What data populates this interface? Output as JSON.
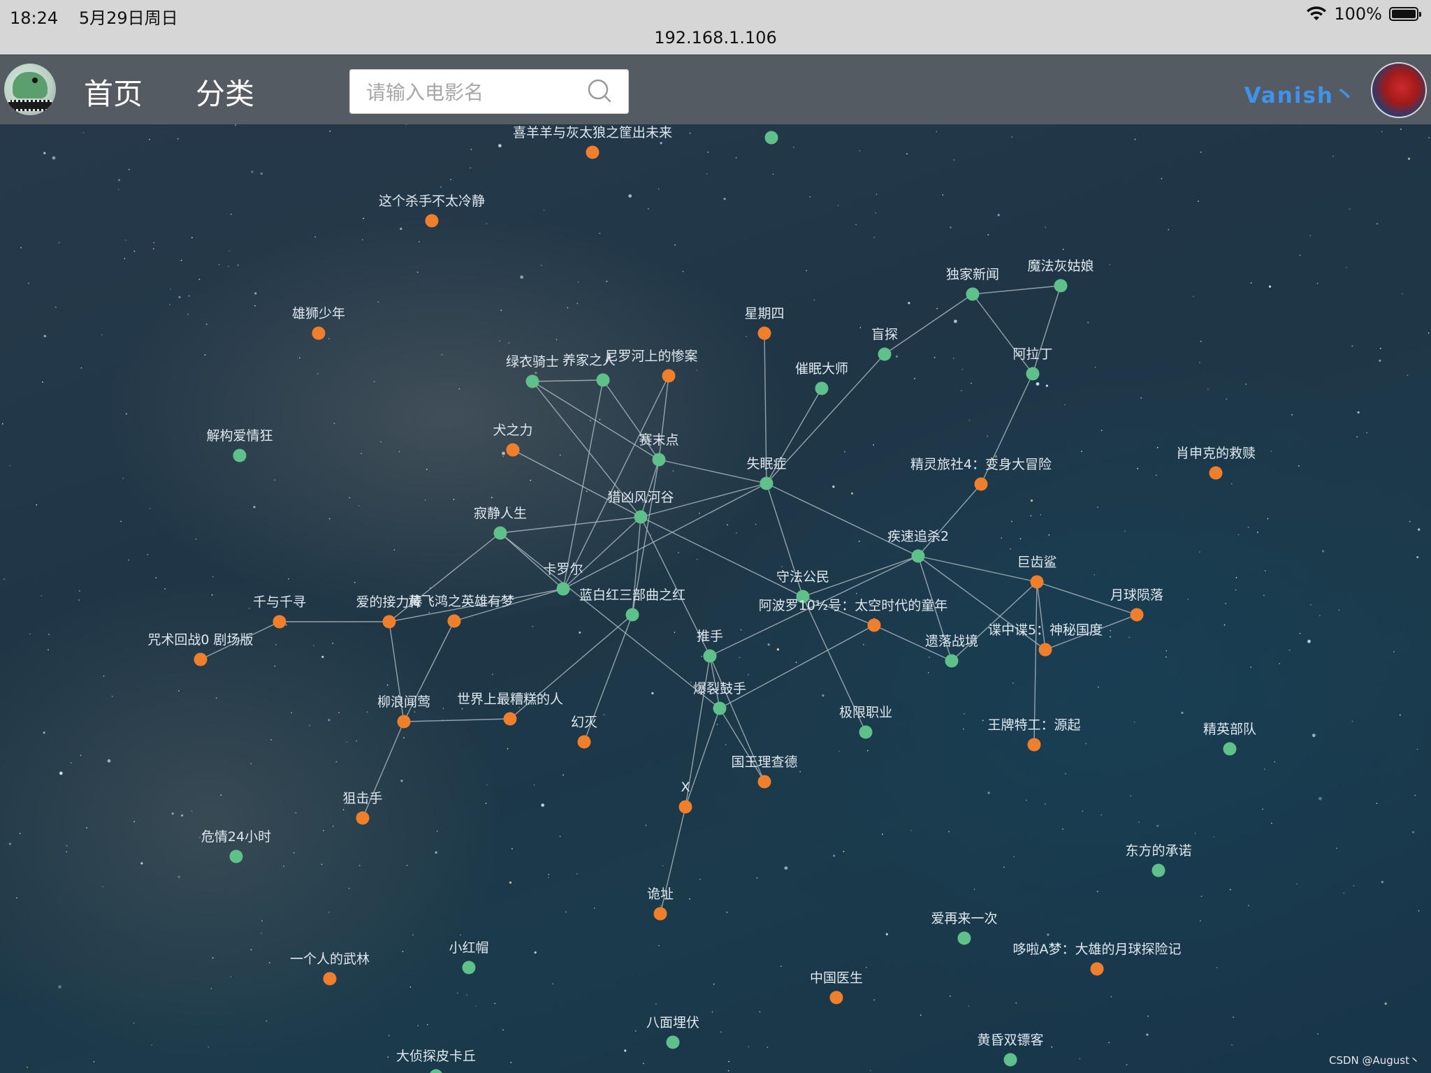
{
  "status_bar": {
    "time": "18:24",
    "date": "5月29日周日",
    "battery": "100%"
  },
  "browser": {
    "url": "192.168.1.106"
  },
  "header": {
    "nav": [
      "首页",
      "分类"
    ],
    "search_placeholder": "请输入电影名",
    "username": "Vanish丶"
  },
  "colors": {
    "green": "#5ec18a",
    "orange": "#f07f2b",
    "edge": "#a9b6bd",
    "header_bg": "#545b62",
    "username": "#3f93ea"
  },
  "graph": {
    "nodes": [
      {
        "id": "喜羊羊与灰太狼之筐出未来",
        "t": "o"
      },
      {
        "id": "这个杀手不太冷静",
        "t": "o"
      },
      {
        "id": "雄狮少年",
        "t": "o"
      },
      {
        "id": "解构爱情狂",
        "t": "g"
      },
      {
        "id": "绿衣骑士",
        "t": "g"
      },
      {
        "id": "养家之人",
        "t": "g"
      },
      {
        "id": "尼罗河上的惨案",
        "t": "o"
      },
      {
        "id": "星期四",
        "t": "o"
      },
      {
        "id": "独家新闻",
        "t": "g"
      },
      {
        "id": "魔法灰姑娘",
        "t": "g"
      },
      {
        "id": "盲探",
        "t": "g"
      },
      {
        "id": "催眠大师",
        "t": "g"
      },
      {
        "id": "阿拉丁",
        "t": "g"
      },
      {
        "id": "犬之力",
        "t": "o"
      },
      {
        "id": "赛末点",
        "t": "g"
      },
      {
        "id": "失眠症",
        "t": "g"
      },
      {
        "id": "精灵旅社4：变身大冒险",
        "t": "o"
      },
      {
        "id": "肖申克的救赎",
        "t": "o"
      },
      {
        "id": "猎凶风河谷",
        "t": "g"
      },
      {
        "id": "寂静人生",
        "t": "g"
      },
      {
        "id": "疾速追杀2",
        "t": "g"
      },
      {
        "id": "巨齿鲨",
        "t": "o"
      },
      {
        "id": "卡罗尔",
        "t": "g"
      },
      {
        "id": "守法公民",
        "t": "g"
      },
      {
        "id": "月球陨落",
        "t": "o"
      },
      {
        "id": "千与千寻",
        "t": "o"
      },
      {
        "id": "爱的接力棒",
        "t": "o"
      },
      {
        "id": "黄飞鸿之英雄有梦",
        "t": "o"
      },
      {
        "id": "蓝白红三部曲之红",
        "t": "g"
      },
      {
        "id": "阿波罗10½号：太空时代的童年",
        "t": "o"
      },
      {
        "id": "谍中谍5：神秘国度",
        "t": "o"
      },
      {
        "id": "咒术回战0 剧场版",
        "t": "o"
      },
      {
        "id": "推手",
        "t": "g"
      },
      {
        "id": "遗落战境",
        "t": "g"
      },
      {
        "id": "爆裂鼓手",
        "t": "g"
      },
      {
        "id": "柳浪闻莺",
        "t": "o"
      },
      {
        "id": "世界上最糟糕的人",
        "t": "o"
      },
      {
        "id": "极限职业",
        "t": "g"
      },
      {
        "id": "幻灭",
        "t": "o"
      },
      {
        "id": "王牌特工：源起",
        "t": "o"
      },
      {
        "id": "精英部队",
        "t": "g"
      },
      {
        "id": "国王理查德",
        "t": "o"
      },
      {
        "id": "狙击手",
        "t": "o"
      },
      {
        "id": "X",
        "t": "o"
      },
      {
        "id": "危情24小时",
        "t": "g"
      },
      {
        "id": "东方的承诺",
        "t": "g"
      },
      {
        "id": "诡址",
        "t": "o"
      },
      {
        "id": "爱再来一次",
        "t": "g"
      },
      {
        "id": "哆啦A梦：大雄的月球探险记",
        "t": "o"
      },
      {
        "id": "一个人的武林",
        "t": "o"
      },
      {
        "id": "小红帽",
        "t": "g"
      },
      {
        "id": "中国医生",
        "t": "o"
      },
      {
        "id": "八面埋伏",
        "t": "g"
      },
      {
        "id": "黄昏双镖客",
        "t": "g"
      },
      {
        "id": "大侦探皮卡丘",
        "t": "g"
      },
      {
        "id": "",
        "t": "g"
      }
    ],
    "edges": [
      [
        "绿衣骑士",
        "养家之人"
      ],
      [
        "绿衣骑士",
        "猎凶风河谷"
      ],
      [
        "绿衣骑士",
        "赛末点"
      ],
      [
        "养家之人",
        "赛末点"
      ],
      [
        "养家之人",
        "卡罗尔"
      ],
      [
        "尼罗河上的惨案",
        "赛末点"
      ],
      [
        "尼罗河上的惨案",
        "卡罗尔"
      ],
      [
        "犬之力",
        "猎凶风河谷"
      ],
      [
        "赛末点",
        "失眠症"
      ],
      [
        "赛末点",
        "猎凶风河谷"
      ],
      [
        "赛末点",
        "蓝白红三部曲之红"
      ],
      [
        "星期四",
        "失眠症"
      ],
      [
        "失眠症",
        "催眠大师"
      ],
      [
        "失眠症",
        "盲探"
      ],
      [
        "失眠症",
        "猎凶风河谷"
      ],
      [
        "失眠症",
        "守法公民"
      ],
      [
        "失眠症",
        "疾速追杀2"
      ],
      [
        "失眠症",
        "卡罗尔"
      ],
      [
        "盲探",
        "独家新闻"
      ],
      [
        "独家新闻",
        "魔法灰姑娘"
      ],
      [
        "独家新闻",
        "阿拉丁"
      ],
      [
        "魔法灰姑娘",
        "阿拉丁"
      ],
      [
        "阿拉丁",
        "精灵旅社4：变身大冒险"
      ],
      [
        "精灵旅社4：变身大冒险",
        "疾速追杀2"
      ],
      [
        "猎凶风河谷",
        "寂静人生"
      ],
      [
        "猎凶风河谷",
        "卡罗尔"
      ],
      [
        "猎凶风河谷",
        "蓝白红三部曲之红"
      ],
      [
        "猎凶风河谷",
        "推手"
      ],
      [
        "猎凶风河谷",
        "守法公民"
      ],
      [
        "寂静人生",
        "卡罗尔"
      ],
      [
        "寂静人生",
        "爆裂鼓手"
      ],
      [
        "寂静人生",
        "爱的接力棒"
      ],
      [
        "卡罗尔",
        "爱的接力棒"
      ],
      [
        "卡罗尔",
        "黄飞鸿之英雄有梦"
      ],
      [
        "疾速追杀2",
        "巨齿鲨"
      ],
      [
        "疾速追杀2",
        "守法公民"
      ],
      [
        "疾速追杀2",
        "遗落战境"
      ],
      [
        "疾速追杀2",
        "推手"
      ],
      [
        "疾速追杀2",
        "谍中谍5：神秘国度"
      ],
      [
        "巨齿鲨",
        "月球陨落"
      ],
      [
        "巨齿鲨",
        "谍中谍5：神秘国度"
      ],
      [
        "巨齿鲨",
        "遗落战境"
      ],
      [
        "巨齿鲨",
        "王牌特工：源起"
      ],
      [
        "月球陨落",
        "谍中谍5：神秘国度"
      ],
      [
        "守法公民",
        "阿波罗10½号：太空时代的童年"
      ],
      [
        "守法公民",
        "极限职业"
      ],
      [
        "阿波罗10½号：太空时代的童年",
        "遗落战境"
      ],
      [
        "阿波罗10½号：太空时代的童年",
        "爆裂鼓手"
      ],
      [
        "千与千寻",
        "爱的接力棒"
      ],
      [
        "咒术回战0 剧场版",
        "千与千寻"
      ],
      [
        "爱的接力棒",
        "柳浪闻莺"
      ],
      [
        "黄飞鸿之英雄有梦",
        "柳浪闻莺"
      ],
      [
        "柳浪闻莺",
        "世界上最糟糕的人"
      ],
      [
        "柳浪闻莺",
        "狙击手"
      ],
      [
        "蓝白红三部曲之红",
        "世界上最糟糕的人"
      ],
      [
        "蓝白红三部曲之红",
        "幻灭"
      ],
      [
        "推手",
        "爆裂鼓手"
      ],
      [
        "推手",
        "国王理查德"
      ],
      [
        "推手",
        "X"
      ],
      [
        "爆裂鼓手",
        "国王理查德"
      ],
      [
        "爆裂鼓手",
        "X"
      ],
      [
        "X",
        "诡址"
      ]
    ]
  }
}
